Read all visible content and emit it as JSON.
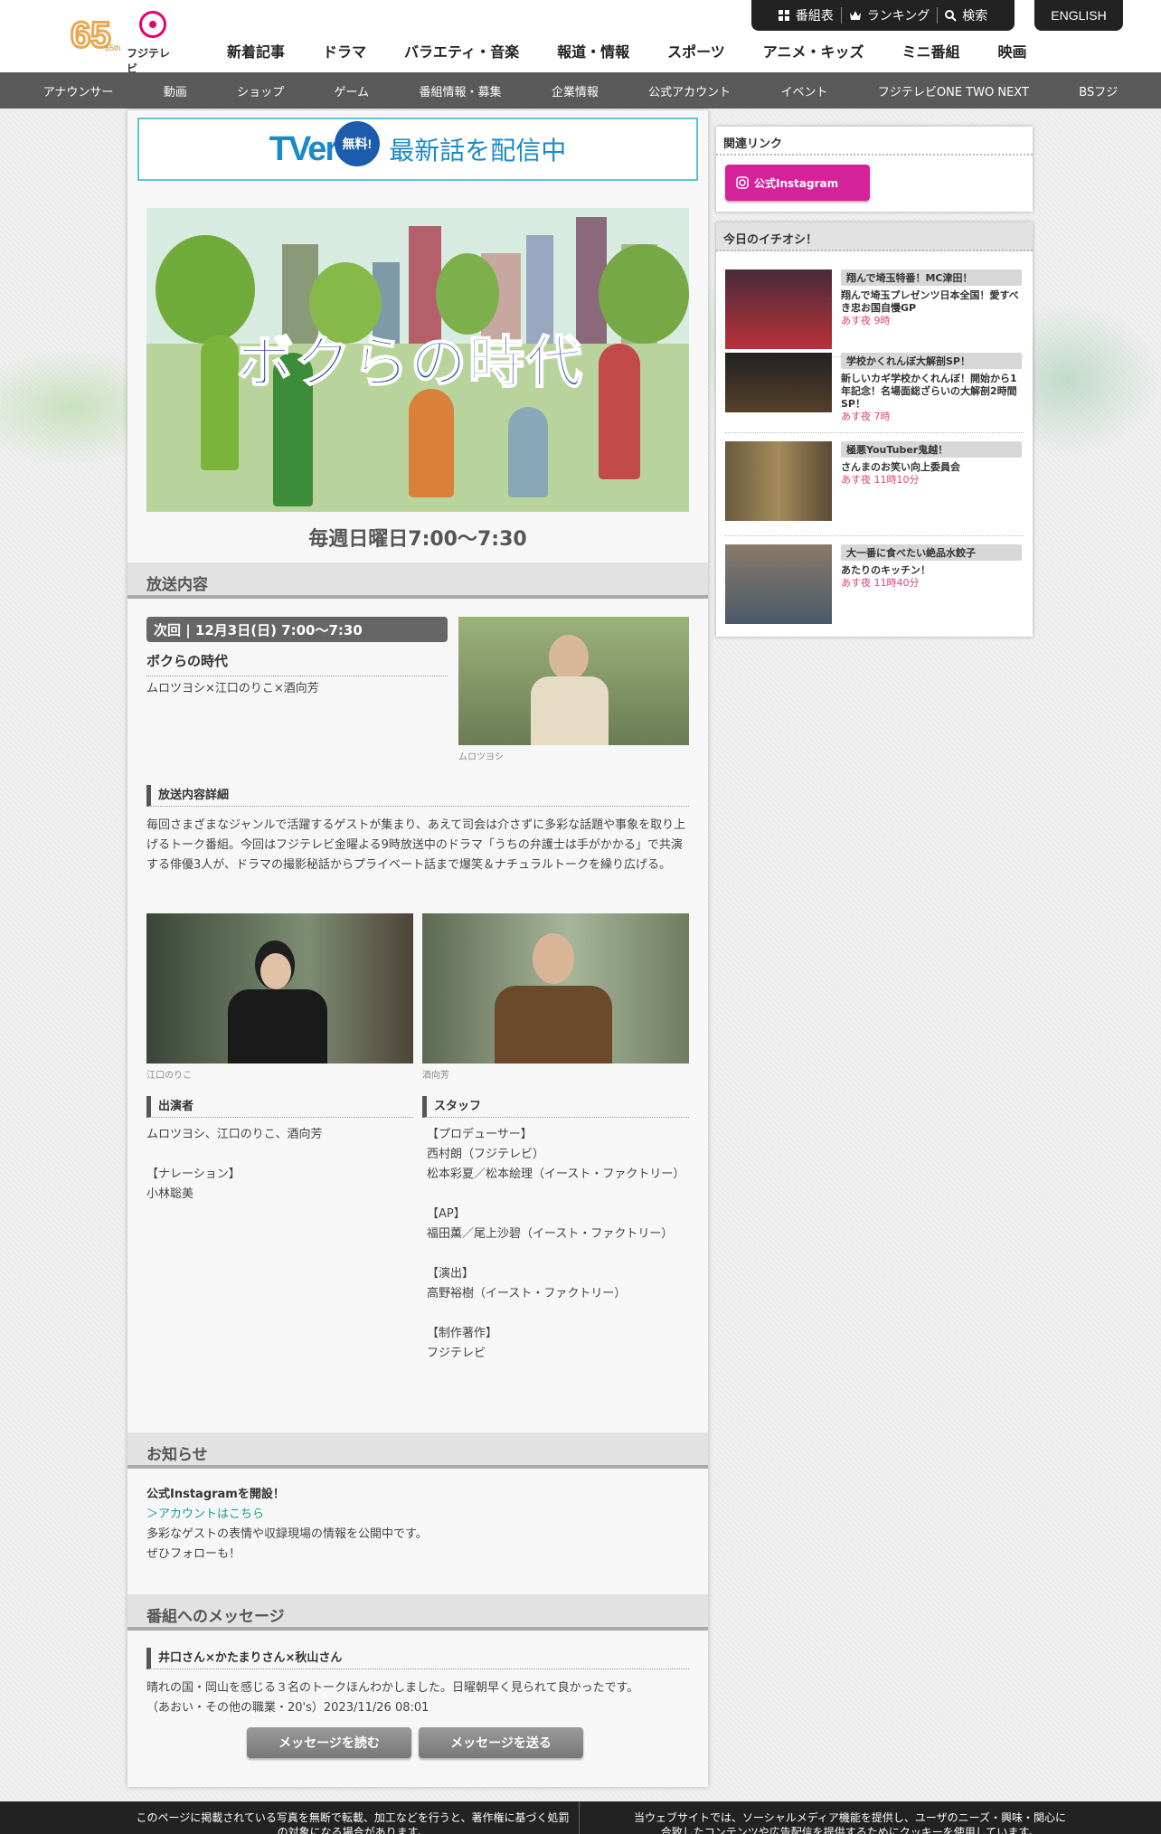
{
  "header": {
    "logo_65_text": "65th",
    "logo_fuji_text": "フジテレビ",
    "topbar": [
      {
        "icon": "grid-icon",
        "label": "番組表"
      },
      {
        "icon": "crown-icon",
        "label": "ランキング"
      },
      {
        "icon": "search-icon",
        "label": "検索"
      }
    ],
    "english": "ENGLISH",
    "nav": [
      "新着記事",
      "ドラマ",
      "バラエティ・音楽",
      "報道・情報",
      "スポーツ",
      "アニメ・キッズ",
      "ミニ番組",
      "映画"
    ],
    "subnav": [
      "アナウンサー",
      "動画",
      "ショップ",
      "ゲーム",
      "番組情報・募集",
      "企業情報",
      "公式アカウント",
      "イベント",
      "フジテレビONE TWO NEXT",
      "BSフジ"
    ]
  },
  "tver": {
    "logo": "TVer",
    "free": "無料!",
    "text": "最新話を配信中"
  },
  "hero": {
    "title": "ボクらの時代"
  },
  "airtime": "毎週日曜日7:00〜7:30",
  "broadcast": {
    "heading": "放送内容",
    "next": "次回 | 12月3日(日) 7:00〜7:30",
    "program": "ボクらの時代",
    "guests": "ムロツヨシ×江口のりこ×酒向芳",
    "photo_caption": "ムロツヨシ",
    "detail_heading": "放送内容詳細",
    "detail_text": "毎回さまざまなジャンルで活躍するゲストが集まり、あえて司会は介さずに多彩な話題や事象を取り上げるトーク番組。今回はフジテレビ金曜よる9時放送中のドラマ「うちの弁護士は手がかかる」で共演する俳優3人が、ドラマの撮影秘話からプライベート話まで爆笑＆ナチュラルトークを繰り広げる。",
    "photo2_caption": "江口のりこ",
    "photo3_caption": "酒向芳",
    "cast_heading": "出演者",
    "cast_text": "ムロツヨシ、江口のりこ、酒向芳\n\n【ナレーション】\n小林聡美",
    "staff_heading": "スタッフ",
    "staff_text": "【プロデューサー】\n西村朗（フジテレビ）\n松本彩夏／松本絵理（イースト・ファクトリー）\n\n【AP】\n福田薫／尾上沙碧（イースト・ファクトリー）\n\n【演出】\n高野裕樹（イースト・ファクトリー）\n\n【制作著作】\nフジテレビ"
  },
  "notice": {
    "heading": "お知らせ",
    "title": "公式Instagramを開設！",
    "link": "＞アカウントはこちら",
    "text": "多彩なゲストの表情や収録現場の情報を公開中です。\nぜひフォローも！"
  },
  "messages": {
    "heading": "番組へのメッセージ",
    "title": "井口さん×かたまりさん×秋山さん",
    "text": "晴れの国・岡山を感じる３名のトークほんわかしました。日曜朝早く見られて良かったです。\n（あおい・その他の職業・20's）2023/11/26 08:01",
    "read_button": "メッセージを読む",
    "send_button": "メッセージを送る"
  },
  "sidebar": {
    "related_heading": "関連リンク",
    "instagram_button": "公式Instagram",
    "pick_heading": "今日のイチオシ！",
    "picks": [
      {
        "tag": "翔んで埼玉特番！MC津田！",
        "title": "翔んで埼玉プレゼンツ日本全国！愛すべき忠お国自慢GP",
        "time": "あす夜 9時"
      },
      {
        "tag": "学校かくれんぼ大解剖SP！",
        "title": "新しいカギ学校かくれんぼ！開始から1年記念！名場面総ざらいの大解剖2時間SP！",
        "time": "あす夜 7時"
      },
      {
        "tag": "極悪YouTuber鬼越！",
        "title": "さんまのお笑い向上委員会",
        "time": "あす夜 11時10分"
      },
      {
        "tag": "大一番に食べたい絶品水餃子",
        "title": "あたりのキッチン！",
        "time": "あす夜 11時40分"
      }
    ]
  },
  "footer": {
    "left": "このページに掲載されている写真を無断で転載、加工などを行うと、著作権に基づく処罰の対象になる場合があります。",
    "right": "当ウェブサイトでは、ソーシャルメディア機能を提供し、ユーザのニーズ・興味・関心に合致したコンテンツや広告配信を提供するためにクッキーを使用しています。"
  },
  "colors": {
    "accent": "#5bc5d5",
    "instagram": "#d4239a",
    "time_red": "#e0447a",
    "subnav": "#5a5a5a"
  }
}
